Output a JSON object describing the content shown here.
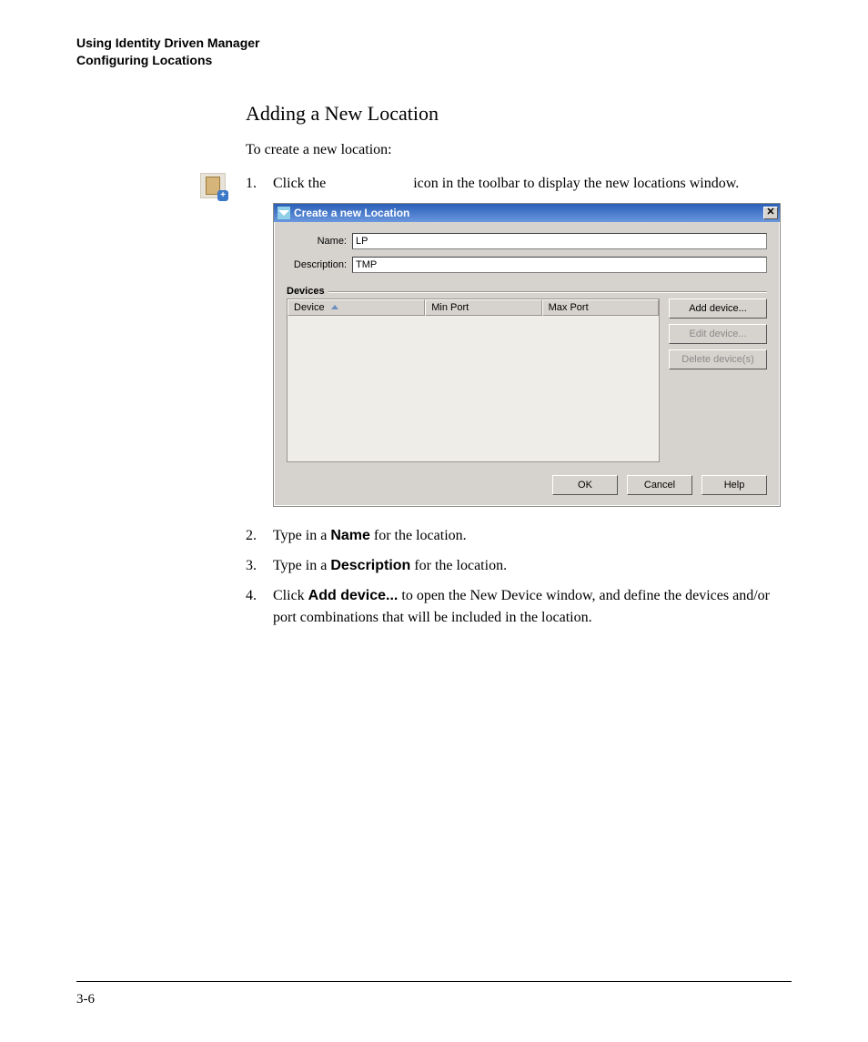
{
  "header": {
    "line1": "Using Identity Driven Manager",
    "line2": "Configuring Locations"
  },
  "section_title": "Adding a New Location",
  "intro": "To create a new location:",
  "steps": {
    "s1_num": "1.",
    "s1_a": "Click the ",
    "s1_b": " icon in the toolbar to display the new locations window.",
    "s2_num": "2.",
    "s2_a": "Type in a ",
    "s2_bold": "Name",
    "s2_b": " for the location.",
    "s3_num": "3.",
    "s3_a": "Type in a ",
    "s3_bold": "Description",
    "s3_b": " for the location.",
    "s4_num": "4.",
    "s4_a": "Click ",
    "s4_bold": "Add device...",
    "s4_b": " to open the New Device window, and define the devices and/or port combinations that will be included in the location."
  },
  "dialog": {
    "title": "Create a new Location",
    "close_glyph": "✕",
    "name_label": "Name:",
    "name_value": "LP",
    "desc_label": "Description:",
    "desc_value": "TMP",
    "devices_group": "Devices",
    "col_device": "Device",
    "col_min": "Min Port",
    "col_max": "Max Port",
    "btn_add": "Add device...",
    "btn_edit": "Edit device...",
    "btn_delete": "Delete device(s)",
    "btn_ok": "OK",
    "btn_cancel": "Cancel",
    "btn_help": "Help"
  },
  "page_number": "3-6"
}
